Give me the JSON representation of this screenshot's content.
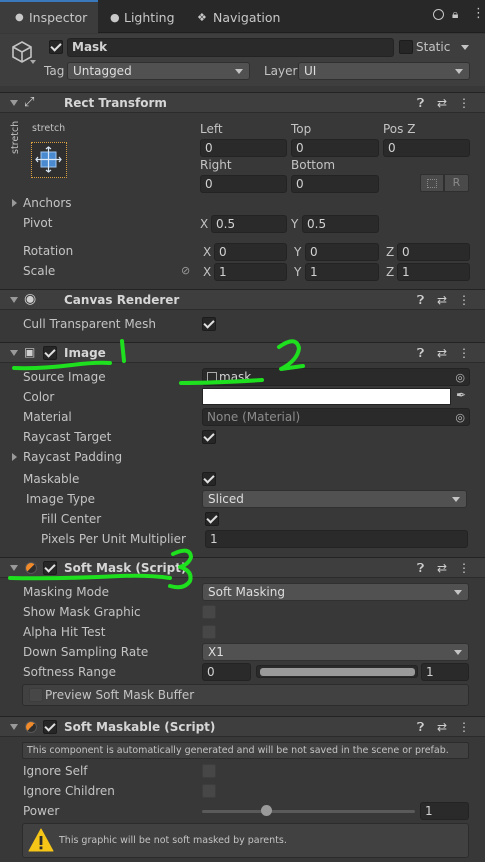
{
  "tabs": {
    "inspector": "Inspector",
    "lighting": "Lighting",
    "navigation": "Navigation"
  },
  "object": {
    "name": "Mask",
    "static_label": "Static",
    "tag_label": "Tag",
    "tag_value": "Untagged",
    "layer_label": "Layer",
    "layer_value": "UI"
  },
  "rect": {
    "title": "Rect Transform",
    "anchor_preset": "stretch",
    "anchor_preset_v": "stretch",
    "left_label": "Left",
    "left": "0",
    "top_label": "Top",
    "top": "0",
    "posz_label": "Pos Z",
    "posz": "0",
    "right_label": "Right",
    "right": "0",
    "bottom_label": "Bottom",
    "bottom": "0",
    "r_button": "R",
    "anchors_label": "Anchors",
    "pivot_label": "Pivot",
    "pivot_x": "0.5",
    "pivot_y": "0.5",
    "rotation_label": "Rotation",
    "rot_x": "0",
    "rot_y": "0",
    "rot_z": "0",
    "scale_label": "Scale",
    "scale_x": "1",
    "scale_y": "1",
    "scale_z": "1",
    "x": "X",
    "y": "Y",
    "z": "Z"
  },
  "canvas": {
    "title": "Canvas Renderer",
    "cull_label": "Cull Transparent Mesh"
  },
  "image": {
    "title": "Image",
    "source_label": "Source Image",
    "source_value": "mask",
    "color_label": "Color",
    "material_label": "Material",
    "material_value": "None (Material)",
    "raycast_label": "Raycast Target",
    "padding_label": "Raycast Padding",
    "maskable_label": "Maskable",
    "type_label": "Image Type",
    "type_value": "Sliced",
    "fill_label": "Fill Center",
    "ppu_label": "Pixels Per Unit Multiplier",
    "ppu_value": "1"
  },
  "softmask": {
    "title": "Soft Mask (Script)",
    "mode_label": "Masking Mode",
    "mode_value": "Soft Masking",
    "show_label": "Show Mask Graphic",
    "alpha_label": "Alpha Hit Test",
    "down_label": "Down Sampling Rate",
    "down_value": "X1",
    "softness_label": "Softness Range",
    "softness_min": "0",
    "softness_max": "1",
    "preview_label": "Preview Soft Mask Buffer"
  },
  "softmaskable": {
    "title": "Soft Maskable (Script)",
    "notice": "This component is automatically generated and will be not saved in the scene or prefab.",
    "ignore_self_label": "Ignore Self",
    "ignore_children_label": "Ignore Children",
    "power_label": "Power",
    "power_value": "1",
    "power_level": 0.3,
    "warning": "This graphic will be not soft masked by parents."
  },
  "colors": {
    "accent": "#3a79bb",
    "annotation": "#1ee01e",
    "warning": "#f5c518"
  },
  "annotations": {
    "one": "1",
    "two": "2",
    "three": "3"
  }
}
